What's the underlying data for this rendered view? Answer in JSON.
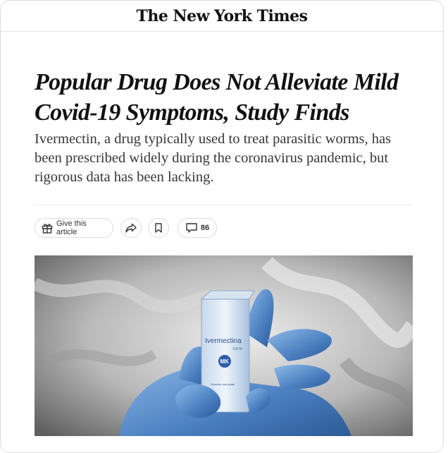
{
  "masthead": {
    "logo_text": "The New York Times"
  },
  "article": {
    "headline": "Popular Drug Does Not Alleviate Mild Covid-19 Symptoms, Study Finds",
    "summary": "Ivermectin, a drug typically used to treat parasitic worms, has been prescribed widely during the coronavirus pandemic, but rigorous data has been lacking."
  },
  "toolbar": {
    "gift_label": "Give this article",
    "comment_count": "86"
  },
  "photo": {
    "product_name": "Ivermectina",
    "product_strength": "0.6 %",
    "brand_mark": "MK",
    "product_form": "Solución oral gotas",
    "volume": "5 mL"
  },
  "colors": {
    "text": "#121212",
    "summary": "#363636",
    "border": "#dcdcdc",
    "glove": "#5a8fcf",
    "box": "#dfe9f4"
  },
  "icons": {
    "gift": "gift-icon",
    "share": "share-arrow-icon",
    "save": "bookmark-icon",
    "comments": "comment-bubble-icon"
  }
}
